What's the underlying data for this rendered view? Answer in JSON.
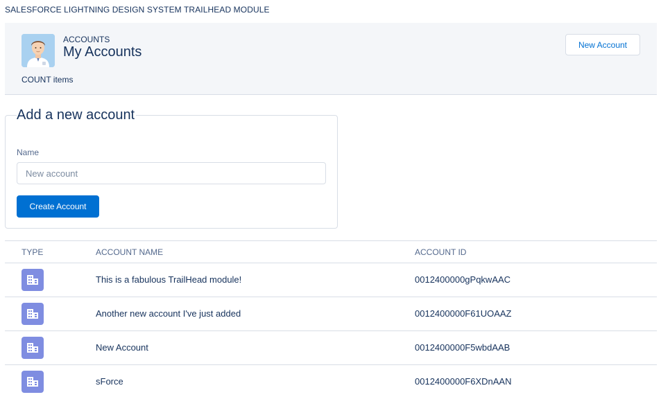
{
  "topbar": {
    "title": "SALESFORCE LIGHTNING DESIGN SYSTEM TRAILHEAD MODULE"
  },
  "header": {
    "eyebrow": "ACCOUNTS",
    "title": "My Accounts",
    "count_text": "COUNT items",
    "new_button_label": "New Account"
  },
  "form": {
    "legend": "Add a new account",
    "name_label": "Name",
    "name_value": "",
    "name_placeholder": "New account",
    "submit_label": "Create Account"
  },
  "table": {
    "headers": {
      "type": "TYPE",
      "name": "ACCOUNT NAME",
      "id": "ACCOUNT ID"
    },
    "rows": [
      {
        "type_icon": "account-icon",
        "name": "This is a fabulous TrailHead module!",
        "id": "0012400000gPqkwAAC"
      },
      {
        "type_icon": "account-icon",
        "name": "Another new account I've just added",
        "id": "0012400000F61UOAAZ"
      },
      {
        "type_icon": "account-icon",
        "name": "New Account",
        "id": "0012400000F5wbdAAB"
      },
      {
        "type_icon": "account-icon",
        "name": "sForce",
        "id": "0012400000F6XDnAAN"
      }
    ]
  },
  "colors": {
    "brand": "#0070d2",
    "text": "#16325c",
    "account_icon_bg": "#7f8de1",
    "header_bg": "#f4f6f9",
    "border": "#d8dde6"
  }
}
